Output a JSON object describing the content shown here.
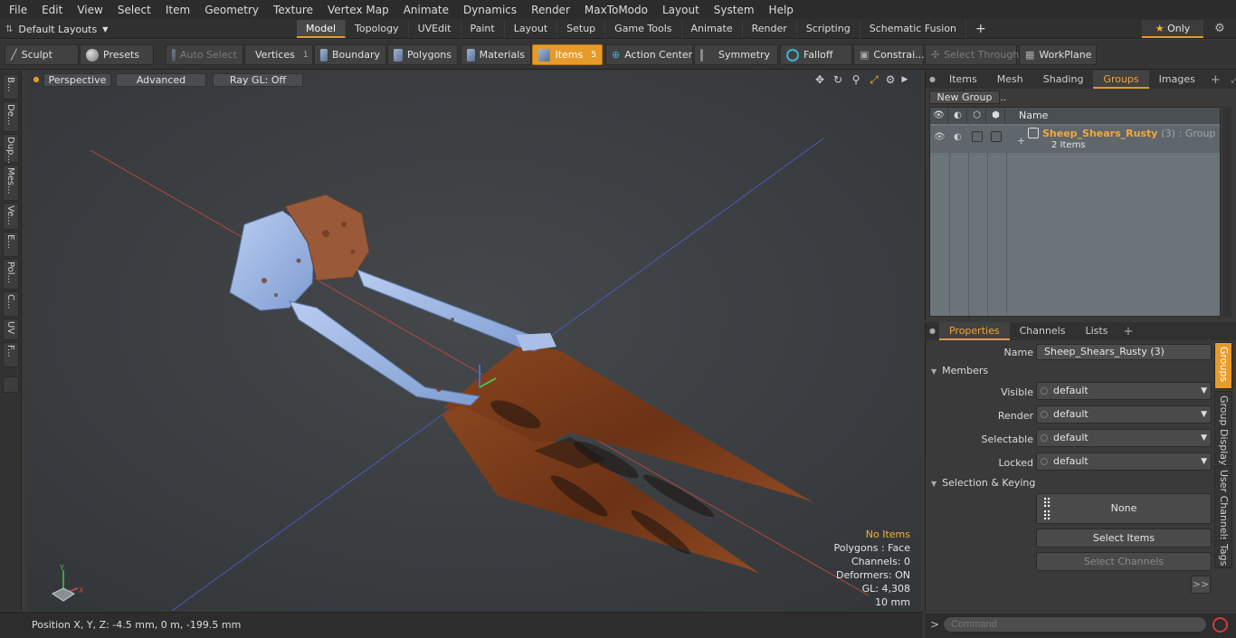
{
  "menu": [
    "File",
    "Edit",
    "View",
    "Select",
    "Item",
    "Geometry",
    "Texture",
    "Vertex Map",
    "Animate",
    "Dynamics",
    "Render",
    "MaxToModo",
    "Layout",
    "System",
    "Help"
  ],
  "layouts": {
    "label": "Default Layouts"
  },
  "tabs": [
    {
      "label": "Model",
      "active": true
    },
    {
      "label": "Topology"
    },
    {
      "label": "UVEdit"
    },
    {
      "label": "Paint"
    },
    {
      "label": "Layout"
    },
    {
      "label": "Setup"
    },
    {
      "label": "Game Tools"
    },
    {
      "label": "Animate"
    },
    {
      "label": "Render"
    },
    {
      "label": "Scripting"
    },
    {
      "label": "Schematic Fusion"
    }
  ],
  "tab_add": "+",
  "only_label": "Only",
  "toolbar": {
    "sculpt": "Sculpt",
    "presets": "Presets",
    "auto_select": "Auto Select",
    "vertices": "Vertices",
    "vertices_count": "1",
    "boundary": "Boundary",
    "polygons": "Polygons",
    "materials": "Materials",
    "items": "Items",
    "items_count": "5",
    "action_center": "Action Center",
    "symmetry": "Symmetry",
    "falloff": "Falloff",
    "constraints": "Constrai...",
    "select_through": "Select Through",
    "workplane": "WorkPlane"
  },
  "left_strip": [
    "B...",
    "De...",
    "Dup...",
    "Mes...",
    "Ve...",
    "E...",
    "Pol...",
    "C...",
    "UV",
    "F..."
  ],
  "viewport": {
    "perspective": "Perspective",
    "advanced": "Advanced",
    "raygl": "Ray GL: Off",
    "info": {
      "items": "No Items",
      "polygons": "Polygons : Face",
      "channels": "Channels: 0",
      "deformers": "Deformers: ON",
      "gl": "GL: 4,308",
      "scale": "10 mm"
    }
  },
  "status": {
    "position": "Position X, Y, Z:  -4.5 mm, 0 m, -199.5 mm"
  },
  "top_panel": {
    "tabs": [
      {
        "label": "Items"
      },
      {
        "label": "Mesh ..."
      },
      {
        "label": "Shading"
      },
      {
        "label": "Groups",
        "active": true
      },
      {
        "label": "Images"
      }
    ],
    "new_group": "New Group",
    "col_name": "Name",
    "group": {
      "name": "Sheep_Shears_Rusty",
      "count": "(3)",
      "type": ": Group",
      "items": "2 Items"
    }
  },
  "props_panel": {
    "tabs": [
      {
        "label": "Properties",
        "active": true
      },
      {
        "label": "Channels"
      },
      {
        "label": "Lists"
      }
    ],
    "name_label": "Name",
    "name_value": "Sheep_Shears_Rusty (3)",
    "members": "Members",
    "visible_label": "Visible",
    "visible_value": "default",
    "render_label": "Render",
    "render_value": "default",
    "selectable_label": "Selectable",
    "selectable_value": "default",
    "locked_label": "Locked",
    "locked_value": "default",
    "sel_keying": "Selection & Keying",
    "none": "None",
    "select_items": "Select Items",
    "select_channels": "Select Channels",
    "more": ">>",
    "side_tabs": [
      "Groups",
      "Group Display",
      "User Channels",
      "Tags"
    ]
  },
  "command": {
    "placeholder": "Command",
    "prompt": ">"
  },
  "colors": {
    "accent": "#e79a27",
    "rust": "#7a3a1a",
    "metal": "#9bb6e6"
  }
}
